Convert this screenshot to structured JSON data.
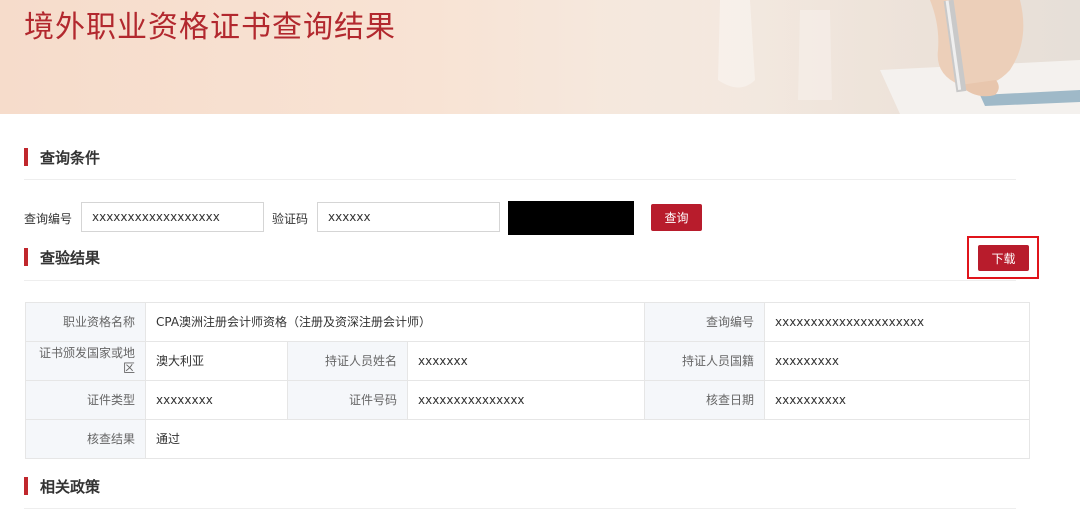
{
  "banner": {
    "title": "境外职业资格证书查询结果"
  },
  "query_section": {
    "heading": "查询条件",
    "query_no_label": "查询编号",
    "query_no_value": "xxxxxxxxxxxxxxxxxx",
    "captcha_label": "验证码",
    "captcha_value": "xxxxxx",
    "search_button": "查询"
  },
  "result_section": {
    "heading": "查验结果",
    "download_button": "下载",
    "rows": {
      "qual_name_k": "职业资格名称",
      "qual_name_v": "CPA澳洲注册会计师资格（注册及资深注册会计师）",
      "query_no_k": "查询编号",
      "query_no_v": "xxxxxxxxxxxxxxxxxxxxx",
      "issuer_k": "证书颁发国家或地区",
      "issuer_v": "澳大利亚",
      "holder_name_k": "持证人员姓名",
      "holder_name_v": "xxxxxxx",
      "nationality_k": "持证人员国籍",
      "nationality_v": "xxxxxxxxx",
      "id_type_k": "证件类型",
      "id_type_v": "xxxxxxxx",
      "id_no_k": "证件号码",
      "id_no_v": "xxxxxxxxxxxxxxx",
      "check_date_k": "核查日期",
      "check_date_v": "xxxxxxxxxx",
      "check_result_k": "核查结果",
      "check_result_v": "通过"
    }
  },
  "policy_section": {
    "heading": "相关政策"
  },
  "colors": {
    "accent": "#b81c2c",
    "highlight": "#e0141b"
  }
}
